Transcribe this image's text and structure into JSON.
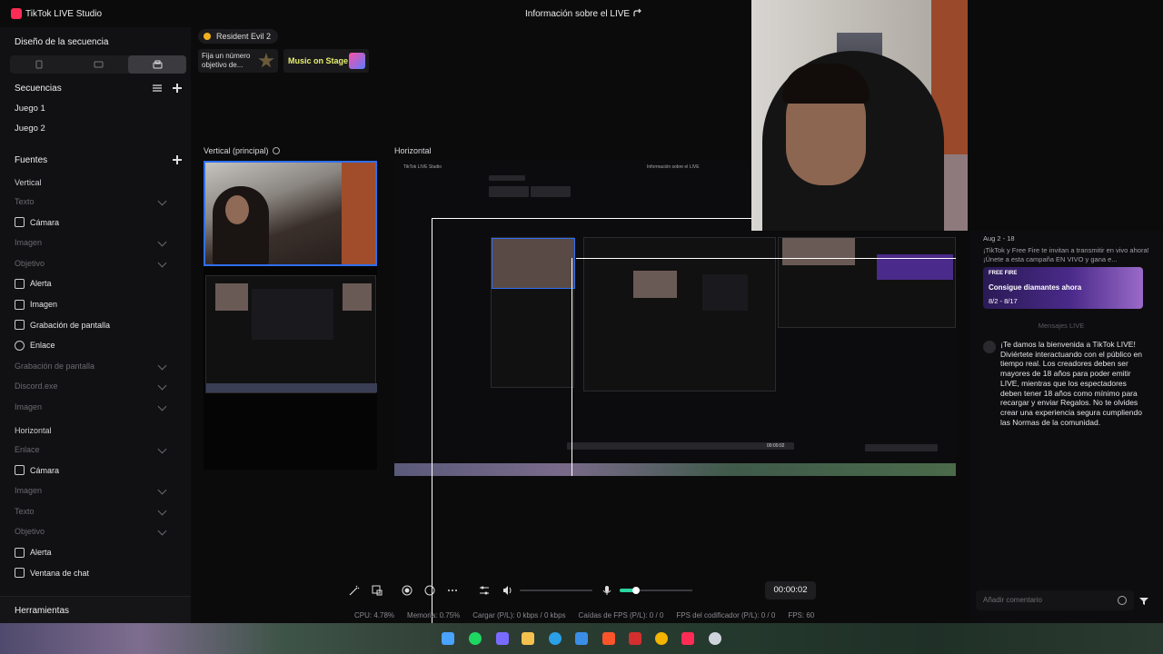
{
  "app": {
    "title": "TikTok LIVE Studio",
    "live_info": "Información sobre el LIVE"
  },
  "sidebar": {
    "layout_title": "Diseño de la secuencia",
    "sequences_title": "Secuencias",
    "sequences": [
      "Juego 1",
      "Juego 2"
    ],
    "sources_title": "Fuentes",
    "vertical_label": "Vertical",
    "vertical_sources": [
      {
        "label": "Texto",
        "dim": true,
        "icon": "text-icon"
      },
      {
        "label": "Cámara",
        "dim": false,
        "icon": "camera-icon"
      },
      {
        "label": "Imagen",
        "dim": true,
        "icon": "image-icon"
      },
      {
        "label": "Objetivo",
        "dim": true,
        "icon": "goal-icon"
      },
      {
        "label": "Alerta",
        "dim": false,
        "icon": "bell-icon"
      },
      {
        "label": "Imagen",
        "dim": false,
        "icon": "image-icon"
      },
      {
        "label": "Grabación de pantalla",
        "dim": false,
        "icon": "monitor-icon"
      },
      {
        "label": "Enlace",
        "dim": false,
        "icon": "globe-icon"
      },
      {
        "label": "Grabación de pantalla",
        "dim": true,
        "icon": "monitor-icon"
      },
      {
        "label": "Discord.exe",
        "dim": true,
        "icon": "window-icon"
      },
      {
        "label": "Imagen",
        "dim": true,
        "icon": "image-icon"
      }
    ],
    "horizontal_label": "Horizontal",
    "horizontal_sources": [
      {
        "label": "Enlace",
        "dim": true,
        "icon": "globe-icon"
      },
      {
        "label": "Cámara",
        "dim": false,
        "icon": "camera-icon"
      },
      {
        "label": "Imagen",
        "dim": true,
        "icon": "image-icon"
      },
      {
        "label": "Texto",
        "dim": true,
        "icon": "text-icon"
      },
      {
        "label": "Objetivo",
        "dim": true,
        "icon": "goal-icon"
      },
      {
        "label": "Alerta",
        "dim": false,
        "icon": "bell-icon"
      },
      {
        "label": "Ventana de chat",
        "dim": false,
        "icon": "chat-icon"
      }
    ],
    "tools_label": "Herramientas"
  },
  "widgets": {
    "game": "Resident Evil 2",
    "goal_text": "Fija un número objetivo de...",
    "music_text": "Music on Stage"
  },
  "previews": {
    "vertical_label": "Vertical (principal)",
    "horizontal_label": "Horizontal"
  },
  "right_panel": {
    "promo_date": "Aug 2 - 18",
    "promo_text": "¡TikTok y Free Fire te invitan a transmitir en vivo ahora! ¡Únete a esta campaña EN VIVO y gana e...",
    "promo_brand": "FREE FIRE",
    "promo_title": "Consigue diamantes ahora",
    "promo_dates": "8/2 - 8/17",
    "messages_label": "Mensajes LIVE",
    "system_message": "¡Te damos la bienvenida a TikTok LIVE! Diviértete interactuando con el público en tiempo real. Los creadores deben ser mayores de 18 años para poder emitir LIVE, mientras que los espectadores deben tener 18 años como mínimo para recargar y enviar Regalos. No te olvides crear una experiencia segura cumpliendo las Normas de la comunidad.",
    "comment_placeholder": "Añadir comentario"
  },
  "controls": {
    "timer": "00:00:02",
    "mic_level": 0.22
  },
  "stats": {
    "cpu": "CPU: 4.78%",
    "memory": "Memoria: 0.75%",
    "upload": "Cargar (P/L): 0 kbps / 0 kbps",
    "fps_drops": "Caídas de FPS (P/L): 0 / 0",
    "encoder_fps": "FPS del codificador (P/L): 0 / 0",
    "fps": "FPS: 60"
  },
  "colors": {
    "accent": "#2f6ff0",
    "mic": "#29d69f",
    "brand": "#fe2c55"
  }
}
